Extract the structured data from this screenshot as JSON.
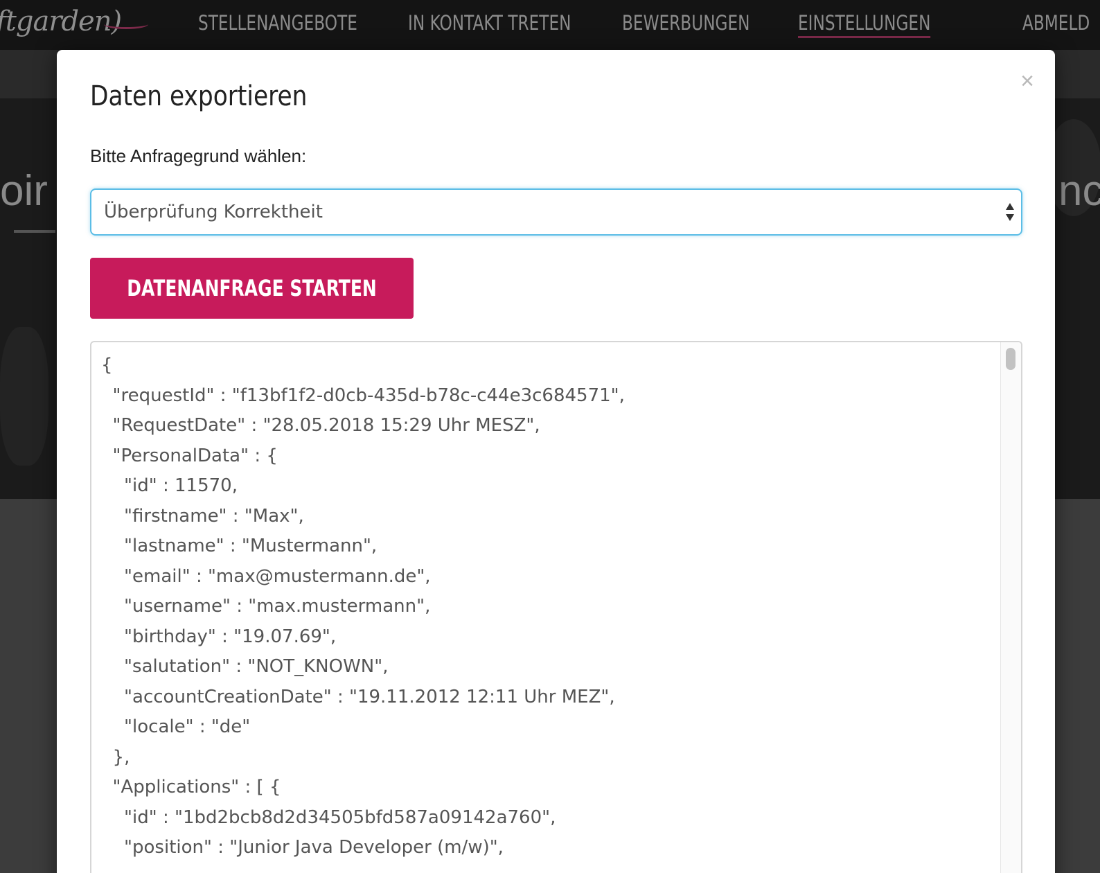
{
  "nav": {
    "logo": "ftgarden)",
    "items": [
      "STELLENANGEBOTE",
      "IN KONTAKT TRETEN",
      "BEWERBUNGEN",
      "EINSTELLUNGEN",
      "ABMELD"
    ]
  },
  "hero": {
    "left_text": "oir",
    "right_text": "nc"
  },
  "modal": {
    "title": "Daten exportieren",
    "close": "×",
    "label": "Bitte Anfragegrund wählen:",
    "select_value": "Überprüfung Korrektheit",
    "start_button": "DATENANFRAGE STARTEN",
    "json_lines": [
      "{",
      "  \"requestId\" : \"f13bf1f2-d0cb-435d-b78c-c44e3c684571\",",
      "  \"RequestDate\" : \"28.05.2018 15:29 Uhr MESZ\",",
      "  \"PersonalData\" : {",
      "    \"id\" : 11570,",
      "    \"firstname\" : \"Max\",",
      "    \"lastname\" : \"Mustermann\",",
      "    \"email\" : \"max@mustermann.de\",",
      "    \"username\" : \"max.mustermann\",",
      "    \"birthday\" : \"19.07.69\",",
      "    \"salutation\" : \"NOT_KNOWN\",",
      "    \"accountCreationDate\" : \"19.11.2012 12:11 Uhr MEZ\",",
      "    \"locale\" : \"de\"",
      "  },",
      "  \"Applications\" : [ {",
      "    \"id\" : \"1bd2bcb8d2d34505bfd587a09142a760\",",
      "    \"position\" : \"Junior Java Developer (m/w)\","
    ]
  },
  "colors": {
    "accent": "#c71b5b",
    "focus": "#5bbde6",
    "nav_bg": "#141414"
  }
}
